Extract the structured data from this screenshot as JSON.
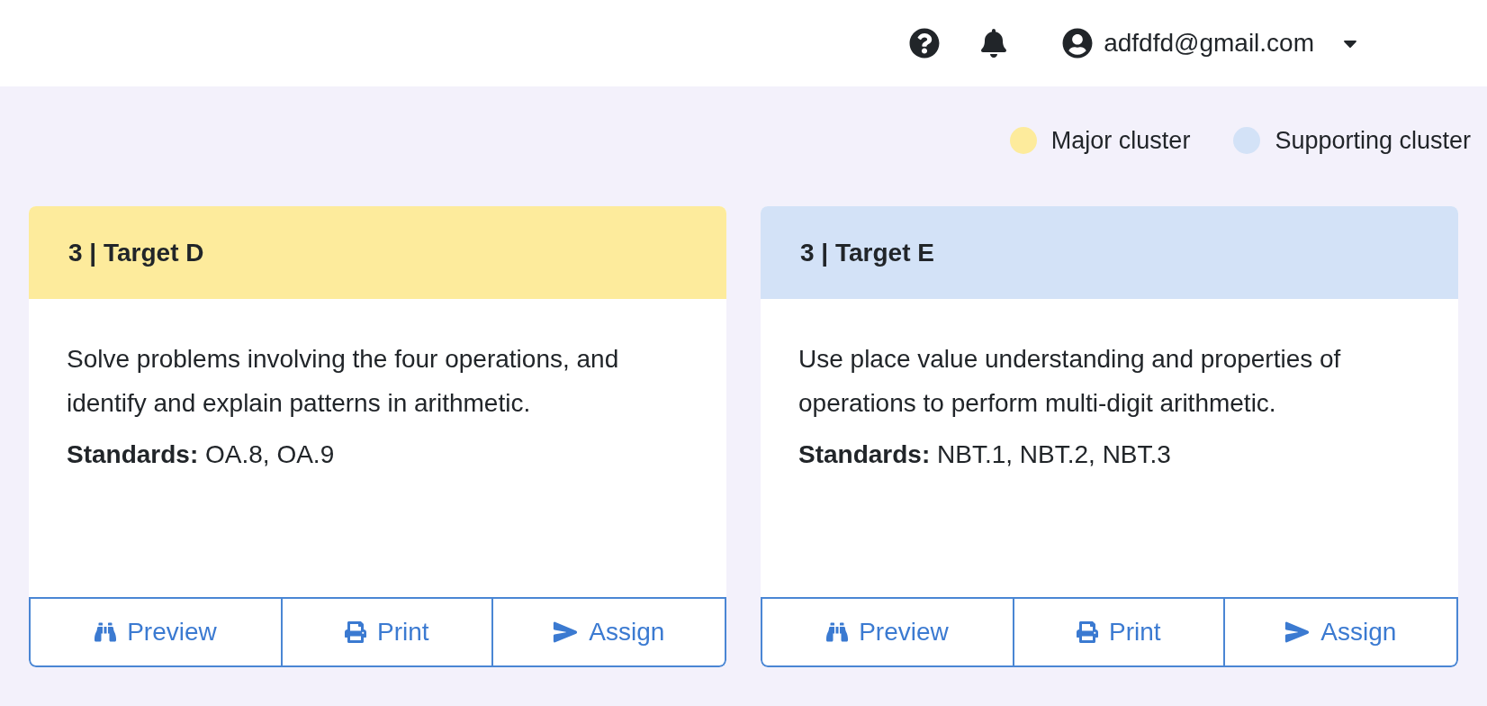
{
  "header": {
    "user_email": "adfdfd@gmail.com"
  },
  "legend": [
    {
      "label": "Major cluster",
      "color": "#fdeb9c"
    },
    {
      "label": "Supporting cluster",
      "color": "#d3e2f7"
    }
  ],
  "cards": [
    {
      "title": "3 | Target D",
      "color": "#fdeb9c",
      "description": "Solve problems involving the four operations, and identify and explain patterns in arithmetic.",
      "standards": "**Standards:** OA.8, OA.9",
      "buttons": [
        {
          "kind": "preview",
          "label": "Preview"
        },
        {
          "kind": "print",
          "label": "Print"
        },
        {
          "kind": "assign",
          "label": "Assign"
        }
      ]
    },
    {
      "title": "3 | Target E",
      "color": "#d3e2f7",
      "description": "Use place value understanding and properties of operations to perform multi-digit arithmetic.",
      "standards": "**Standards:** NBT.1, NBT.2, NBT.3",
      "buttons": [
        {
          "kind": "preview",
          "label": "Preview"
        },
        {
          "kind": "print",
          "label": "Print"
        },
        {
          "kind": "assign",
          "label": "Assign"
        }
      ]
    }
  ]
}
